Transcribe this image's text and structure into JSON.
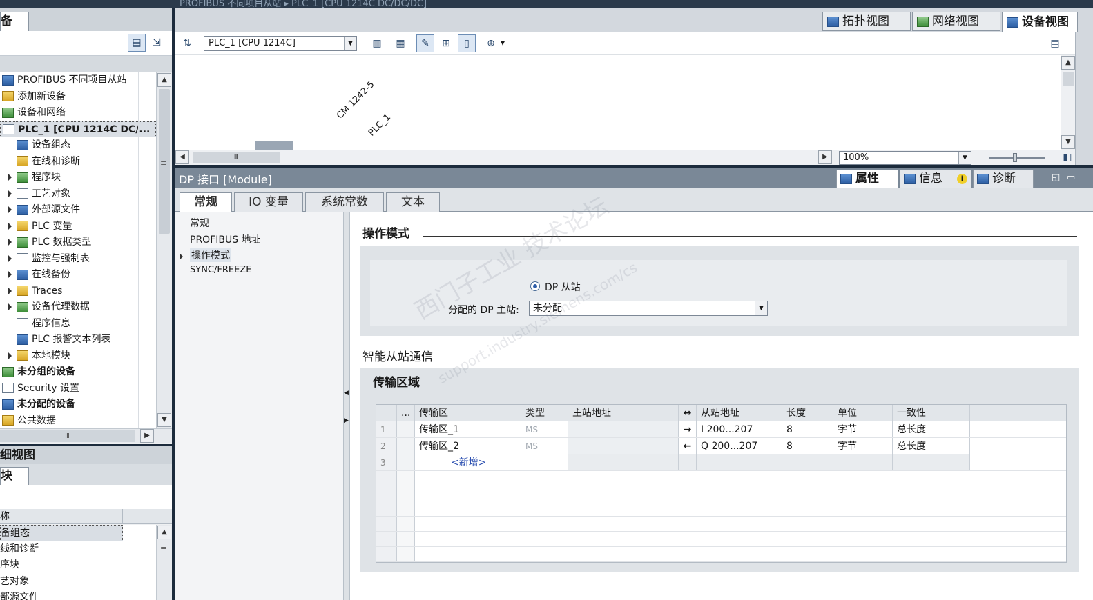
{
  "window_title": "PROFIBUS 不同项目从站 ▸ PLC_1 [CPU 1214C DC/DC/DC]",
  "left": {
    "panel_title": "备",
    "tab": "",
    "tree": [
      {
        "label": "PROFIBUS 不同项目从站",
        "indent": 0,
        "arrow": false,
        "icon": "project-icon",
        "bold": false
      },
      {
        "label": "添加新设备",
        "indent": 0,
        "arrow": false,
        "icon": "add-device-icon",
        "bold": false
      },
      {
        "label": "设备和网络",
        "indent": 0,
        "arrow": false,
        "icon": "network-icon",
        "bold": false
      },
      {
        "label": "PLC_1 [CPU 1214C DC/...",
        "indent": 0,
        "arrow": false,
        "icon": "plc-icon",
        "bold": true,
        "selected": true
      },
      {
        "label": "设备组态",
        "indent": 1,
        "arrow": false,
        "icon": "device-config-icon",
        "bold": false
      },
      {
        "label": "在线和诊断",
        "indent": 1,
        "arrow": false,
        "icon": "online-diag-icon",
        "bold": false
      },
      {
        "label": "程序块",
        "indent": 1,
        "arrow": true,
        "icon": "program-block-icon",
        "bold": false
      },
      {
        "label": "工艺对象",
        "indent": 1,
        "arrow": true,
        "icon": "tech-object-icon",
        "bold": false
      },
      {
        "label": "外部源文件",
        "indent": 1,
        "arrow": true,
        "icon": "source-file-icon",
        "bold": false
      },
      {
        "label": "PLC 变量",
        "indent": 1,
        "arrow": true,
        "icon": "plc-tag-icon",
        "bold": false
      },
      {
        "label": "PLC 数据类型",
        "indent": 1,
        "arrow": true,
        "icon": "plc-datatype-icon",
        "bold": false
      },
      {
        "label": "监控与强制表",
        "indent": 1,
        "arrow": true,
        "icon": "watch-table-icon",
        "bold": false
      },
      {
        "label": "在线备份",
        "indent": 1,
        "arrow": true,
        "icon": "online-backup-icon",
        "bold": false
      },
      {
        "label": "Traces",
        "indent": 1,
        "arrow": true,
        "icon": "traces-icon",
        "bold": false
      },
      {
        "label": "设备代理数据",
        "indent": 1,
        "arrow": true,
        "icon": "proxy-data-icon",
        "bold": false
      },
      {
        "label": "程序信息",
        "indent": 1,
        "arrow": false,
        "icon": "program-info-icon",
        "bold": false
      },
      {
        "label": "PLC 报警文本列表",
        "indent": 1,
        "arrow": false,
        "icon": "alarm-text-icon",
        "bold": false
      },
      {
        "label": "本地模块",
        "indent": 1,
        "arrow": true,
        "icon": "local-module-icon",
        "bold": false
      },
      {
        "label": "未分组的设备",
        "indent": 0,
        "arrow": false,
        "icon": "ungrouped-icon",
        "bold": true
      },
      {
        "label": "Security 设置",
        "indent": 0,
        "arrow": false,
        "icon": "security-icon",
        "bold": false
      },
      {
        "label": "未分配的设备",
        "indent": 0,
        "arrow": false,
        "icon": "unassigned-icon",
        "bold": true
      },
      {
        "label": "公共数据",
        "indent": 0,
        "arrow": false,
        "icon": "common-data-icon",
        "bold": false
      }
    ],
    "hscroll_grip": "Ⅲ",
    "detail_title": "细视图",
    "detail_tab": "块",
    "detail_col": "称",
    "detail_items": [
      "备组态",
      "线和诊断",
      "序块",
      "艺对象",
      "部源文件"
    ]
  },
  "view_tabs": {
    "topology": "拓扑视图",
    "network": "网络视图",
    "device": "设备视图"
  },
  "toolbar": {
    "device_select": "PLC_1 [CPU 1214C]"
  },
  "canvas": {
    "label1": "CM 1242-5",
    "label2": "PLC_1",
    "zoom": "100%",
    "hscroll_grip": "Ⅲ"
  },
  "props": {
    "title": "DP 接口 [Module]",
    "right_tabs": {
      "properties": "属性",
      "info": "信息",
      "diagnostics": "诊断"
    },
    "tabs": [
      "常规",
      "IO 变量",
      "系统常数",
      "文本"
    ],
    "nav": [
      "常规",
      "PROFIBUS 地址",
      "操作模式",
      "SYNC/FREEZE"
    ],
    "section1": "操作模式",
    "radio_label": "DP 从站",
    "master_label": "分配的 DP 主站:",
    "master_value": "未分配",
    "section2": "智能从站通信",
    "subsection": "传输区域",
    "grid": {
      "headers": [
        "...",
        "传输区",
        "类型",
        "主站地址",
        "↔",
        "从站地址",
        "长度",
        "单位",
        "一致性"
      ],
      "rows": [
        {
          "n": "1",
          "name": "传输区_1",
          "type": "MS",
          "master": "",
          "dir": "→",
          "slave": "I 200...207",
          "len": "8",
          "unit": "字节",
          "cons": "总长度"
        },
        {
          "n": "2",
          "name": "传输区_2",
          "type": "MS",
          "master": "",
          "dir": "←",
          "slave": "Q 200...207",
          "len": "8",
          "unit": "字节",
          "cons": "总长度"
        }
      ],
      "add_row_n": "3",
      "add_label": "<新增>"
    }
  },
  "watermark": {
    "line1": "西门子工业 技术论坛",
    "line2": "support.industry.siemens.com/cs"
  }
}
